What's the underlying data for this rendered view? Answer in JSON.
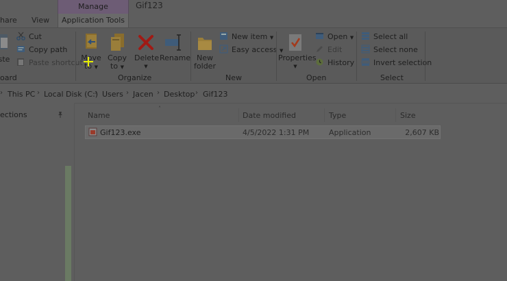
{
  "window": {
    "title": "Gif123"
  },
  "tabs": {
    "share": "hare",
    "view": "View",
    "context_group": "Manage",
    "application_tools": "Application Tools"
  },
  "ribbon": {
    "clipboard": {
      "group_label": "oard",
      "paste_partial": "ste",
      "cut": "Cut",
      "copy_path": "Copy path",
      "paste_shortcut": "Paste shortcut"
    },
    "organize": {
      "group_label": "Organize",
      "move_to": [
        "Move",
        "to"
      ],
      "copy_to": [
        "Copy",
        "to"
      ],
      "delete": "Delete",
      "rename": "Rename"
    },
    "new": {
      "group_label": "New",
      "new_folder": [
        "New",
        "folder"
      ],
      "new_item": "New item",
      "easy_access": "Easy access"
    },
    "open": {
      "group_label": "Open",
      "properties": "Properties",
      "open": "Open",
      "edit": "Edit",
      "history": "History"
    },
    "select": {
      "group_label": "Select",
      "select_all": "Select all",
      "select_none": "Select none",
      "invert_selection": "Invert selection"
    }
  },
  "address": {
    "crumbs": [
      "This PC",
      "Local Disk (C:)",
      "Users",
      "Jacen",
      "Desktop",
      "Gif123"
    ]
  },
  "nav": {
    "quick_access_partial": "ections"
  },
  "file_list": {
    "columns": [
      "Name",
      "Date modified",
      "Type",
      "Size"
    ],
    "rows": [
      {
        "name": "Gif123.exe",
        "date_modified": "4/5/2022 1:31 PM",
        "type": "Application",
        "size": "2,607 KB"
      }
    ]
  },
  "colors": {
    "background_dimmed": "#5e5e5e",
    "manage_context_tab": "#6d5c75",
    "cursor_crosshair": "#e8f000",
    "delete_icon": "#a11a14",
    "selected_row": "#6a6a6a"
  }
}
